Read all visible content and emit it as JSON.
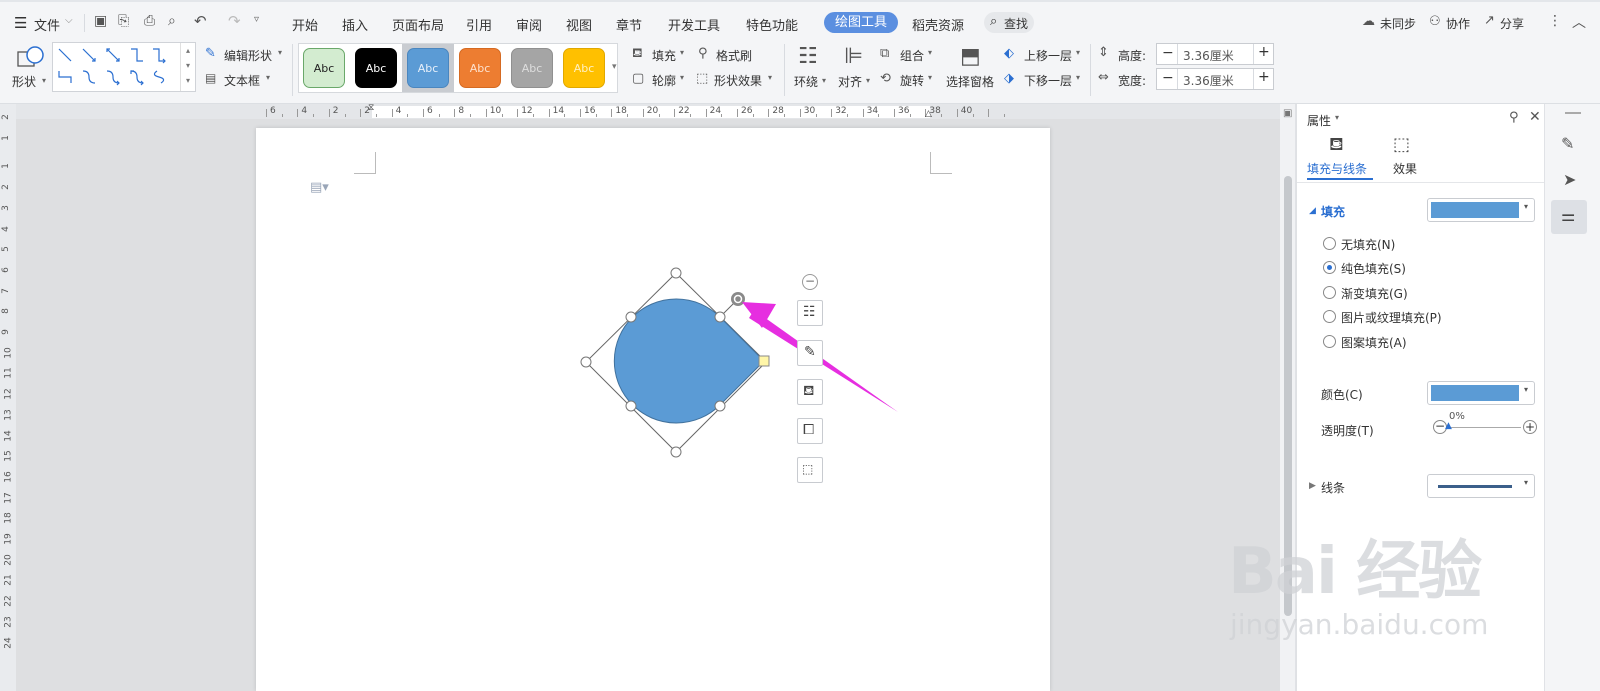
{
  "menubar": {
    "file_label": "文件",
    "tabs": [
      "开始",
      "插入",
      "页面布局",
      "引用",
      "审阅",
      "视图",
      "章节",
      "开发工具",
      "特色功能"
    ],
    "active_tab": "绘图工具",
    "resource_tab": "稻壳资源",
    "search_label": "查找",
    "sync_label": "未同步",
    "collab_label": "协作",
    "share_label": "分享"
  },
  "ribbon": {
    "shape_label": "形状",
    "edit_shape_label": "编辑形状",
    "textbox_label": "文本框",
    "style_swatches": [
      {
        "label": "Abc",
        "bg": "#d3ecd0",
        "fg": "#222",
        "border": "#6aa86a"
      },
      {
        "label": "Abc",
        "bg": "#000000",
        "fg": "#ffffff",
        "border": "#000000"
      },
      {
        "label": "Abc",
        "bg": "#5b9bd5",
        "fg": "#e8f0fa",
        "border": "#4a86bf"
      },
      {
        "label": "Abc",
        "bg": "#ed7d31",
        "fg": "#fde2cf",
        "border": "#d56a22"
      },
      {
        "label": "Abc",
        "bg": "#a5a5a5",
        "fg": "#dedede",
        "border": "#909090"
      },
      {
        "label": "Abc",
        "bg": "#ffc000",
        "fg": "#fff0c2",
        "border": "#e0a800"
      }
    ],
    "fill_label": "填充",
    "format_painter_label": "格式刷",
    "outline_label": "轮廓",
    "shape_effect_label": "形状效果",
    "wrap_label": "环绕",
    "align_label": "对齐",
    "group_label": "组合",
    "rotate_label": "旋转",
    "select_pane_label": "选择窗格",
    "bring_forward_label": "上移一层",
    "send_backward_label": "下移一层",
    "height_label": "高度:",
    "height_value": "3.36厘米",
    "width_label": "宽度:",
    "width_value": "3.36厘米"
  },
  "ruler": {
    "h_ticks": [
      "6",
      "4",
      "2",
      "2",
      "4",
      "6",
      "8",
      "10",
      "12",
      "14",
      "16",
      "18",
      "20",
      "22",
      "24",
      "26",
      "28",
      "30",
      "32",
      "34",
      "36",
      "38",
      "40"
    ],
    "v_ticks": [
      "2",
      "1",
      "1",
      "2",
      "3",
      "4",
      "5",
      "6",
      "7",
      "8",
      "9",
      "10",
      "11",
      "12",
      "13",
      "14",
      "15",
      "16",
      "17",
      "18",
      "19",
      "20",
      "21",
      "22",
      "23",
      "24"
    ]
  },
  "panel": {
    "title": "属性",
    "tab_fill_line": "填充与线条",
    "tab_effect": "效果",
    "fill_section": "填充",
    "fill_color": "#5b9bd5",
    "options": [
      "无填充(N)",
      "纯色填充(S)",
      "渐变填充(G)",
      "图片或纹理填充(P)",
      "图案填充(A)"
    ],
    "selected_option": 1,
    "color_label": "颜色(C)",
    "transparency_label": "透明度(T)",
    "transparency_value": "0%",
    "line_section": "线条",
    "line_color": "#3b5f8a"
  },
  "shape": {
    "fill": "#5b9bd5",
    "outline": "#41719c"
  },
  "annotation": {
    "arrow_color": "#e62ee0"
  },
  "watermark": {
    "logo": "Bai  经验",
    "url": "jingyan.baidu.com"
  }
}
